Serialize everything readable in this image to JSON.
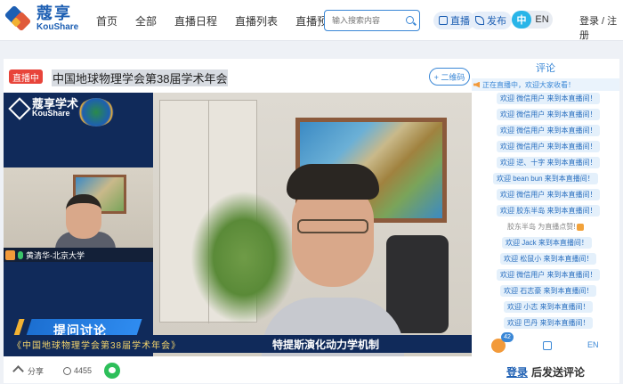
{
  "header": {
    "logo_cn": "蔻享",
    "logo_en": "KouShare",
    "nav": [
      "首页",
      "全部",
      "直播日程",
      "直播列表",
      "直播预约"
    ],
    "search_placeholder": "输入搜索内容",
    "live_label": "直播",
    "publish_label": "发布",
    "lang_zh": "中",
    "lang_en": "EN",
    "auth": "登录 / 注册"
  },
  "stream": {
    "badge": "直播中",
    "title": "中国地球物理学会第38届学术年会",
    "qr_button": "+ 二维码",
    "overlay_logo_cn": "蔻享学术",
    "overlay_logo_en": "KouShare",
    "speaker": "黄清华-北京大学",
    "qa_label": "提问讨论",
    "caption_left": "《中国地球物理学会第38届学术年会》",
    "caption_right": "特提斯演化动力学机制",
    "share": "分享",
    "views": "4455"
  },
  "comments": {
    "title": "评论",
    "notice": "正在直播中，欢迎大家收看！",
    "messages": [
      {
        "text": "欢迎 微信用户 来到本直播间！",
        "type": "join"
      },
      {
        "text": "欢迎 微信用户 来到本直播间！",
        "type": "join"
      },
      {
        "text": "欢迎 微信用户 来到本直播间！",
        "type": "join"
      },
      {
        "text": "欢迎 微信用户 来到本直播间！",
        "type": "join"
      },
      {
        "text": "欢迎 逆、十字 来到本直播间！",
        "type": "join"
      },
      {
        "text": "欢迎 bean bun 来到本直播间！",
        "type": "join"
      },
      {
        "text": "欢迎 微信用户 来到本直播间！",
        "type": "join"
      },
      {
        "text": "欢迎 胶东半岛 来到本直播间！",
        "type": "join"
      },
      {
        "text": "胶东半岛 为直播点赞!",
        "type": "like"
      },
      {
        "text": "欢迎 Jack 来到本直播间！",
        "type": "join"
      },
      {
        "text": "欢迎 松鼠小 来到本直播间！",
        "type": "join"
      },
      {
        "text": "欢迎 微信用户 来到本直播间！",
        "type": "join"
      },
      {
        "text": "欢迎 石志豪 来到本直播间！",
        "type": "join"
      },
      {
        "text": "欢迎 小志 来到本直播间！",
        "type": "join"
      },
      {
        "text": "欢迎 巴丹 来到本直播间！",
        "type": "join"
      }
    ],
    "like_count": "42",
    "lang": "EN",
    "login_link": "登录",
    "login_suffix": "后发送评论"
  }
}
